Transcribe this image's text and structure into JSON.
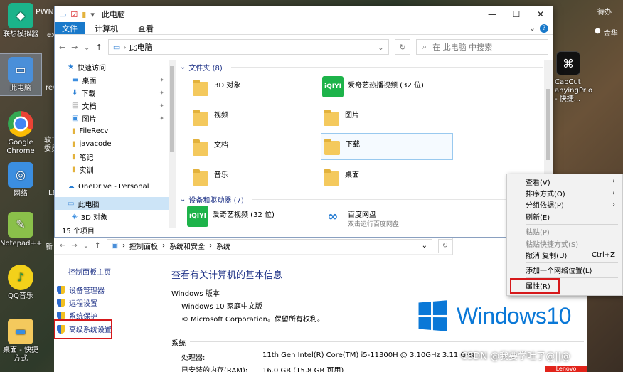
{
  "desktop": {
    "icons": [
      {
        "label": "联想模拟器",
        "color": "#1bb38a",
        "glyph": "◆"
      },
      {
        "label": "此电脑",
        "color": "#4a8fd9",
        "glyph": "▭"
      },
      {
        "label": "Google Chrome",
        "color": "#ffffff",
        "glyph": "●"
      },
      {
        "label": "网络",
        "color": "#3b8ee0",
        "glyph": "◎"
      },
      {
        "label": "Notepad++",
        "color": "#8ac04a",
        "glyph": "✎"
      },
      {
        "label": "QQ音乐",
        "color": "#f3d11a",
        "glyph": "♪"
      },
      {
        "label": "桌面 - 快捷方式",
        "color": "#f4c95d",
        "glyph": "▬"
      }
    ],
    "partials": [
      {
        "label": "PWN"
      },
      {
        "label": "ex"
      },
      {
        "label": "rev"
      },
      {
        "label": "软工"
      },
      {
        "label": "委员"
      },
      {
        "label": "LE"
      },
      {
        "label": "新"
      }
    ],
    "notification": "待办",
    "weather": "金华",
    "capcut_label": "CapCut anyingPr o - 快捷..."
  },
  "explorer": {
    "title": "此电脑",
    "ribbon": {
      "file": "文件",
      "tab1": "计算机",
      "tab2": "查看"
    },
    "address": "此电脑",
    "search_placeholder": "在 此电脑 中搜索",
    "nav": {
      "quick_access": "快速访问",
      "items": [
        {
          "label": "桌面",
          "pinned": true
        },
        {
          "label": "下载",
          "pinned": true
        },
        {
          "label": "文档",
          "pinned": true
        },
        {
          "label": "图片",
          "pinned": true
        },
        {
          "label": "FileRecv",
          "pinned": false
        },
        {
          "label": "javacode",
          "pinned": false
        },
        {
          "label": "笔记",
          "pinned": false
        },
        {
          "label": "实训",
          "pinned": false
        }
      ],
      "onedrive": "OneDrive - Personal",
      "this_pc": "此电脑",
      "objects_3d": "3D 对象"
    },
    "status": "15 个项目",
    "groups": {
      "folders": "文件夹 (8)",
      "devices": "设备和驱动器 (7)"
    },
    "folders": [
      "3D 对象",
      "爱奇艺热播视频 (32 位)",
      "视频",
      "图片",
      "文档",
      "下载",
      "音乐",
      "桌面"
    ],
    "devices": [
      {
        "label": "爱奇艺视频 (32 位)",
        "sub": ""
      },
      {
        "label": "百度网盘",
        "sub": "双击运行百度网盘"
      }
    ],
    "iqiyi_logo": "iQIYI"
  },
  "system": {
    "breadcrumb": [
      "控制面板",
      "系统和安全",
      "系统"
    ],
    "cpanel_home": "控制面板主页",
    "links": [
      "设备管理器",
      "远程设置",
      "系统保护",
      "高级系统设置"
    ],
    "heading": "查看有关计算机的基本信息",
    "edition_section": "Windows 版本",
    "edition": "Windows 10 家庭中文版",
    "copyright": "© Microsoft Corporation。保留所有权利。",
    "logo_text": "Windows10",
    "system_section": "系统",
    "processor_label": "处理器:",
    "processor_value": "11th Gen Intel(R) Core(TM) i5-11300H @ 3.10GHz   3.11 GHz",
    "ram_label": "已安装的内存(RAM):",
    "ram_value": "16.0 GB (15.8 GB 可用)",
    "brand": "Lenovo"
  },
  "context_menu": {
    "items": [
      {
        "label": "查看(V)",
        "shortcut": "",
        "submenu": true,
        "disabled": false
      },
      {
        "label": "排序方式(O)",
        "shortcut": "",
        "submenu": true,
        "disabled": false
      },
      {
        "label": "分组依据(P)",
        "shortcut": "",
        "submenu": true,
        "disabled": false
      },
      {
        "label": "刷新(E)",
        "shortcut": "",
        "submenu": false,
        "disabled": false
      },
      {
        "label": "粘贴(P)",
        "shortcut": "",
        "submenu": false,
        "disabled": true
      },
      {
        "label": "粘贴快捷方式(S)",
        "shortcut": "",
        "submenu": false,
        "disabled": true
      },
      {
        "label": "撤消 复制(U)",
        "shortcut": "Ctrl+Z",
        "submenu": false,
        "disabled": false
      },
      {
        "label": "添加一个网络位置(L)",
        "shortcut": "",
        "submenu": false,
        "disabled": false
      },
      {
        "label": "属性(R)",
        "shortcut": "",
        "submenu": false,
        "disabled": false
      }
    ]
  },
  "watermark": "CSDN @我要学吐了@||@",
  "colors": {
    "accent": "#1979ca",
    "highlight_red": "#d6191b",
    "link": "#1e3287",
    "windows_blue": "#0a78d7"
  }
}
